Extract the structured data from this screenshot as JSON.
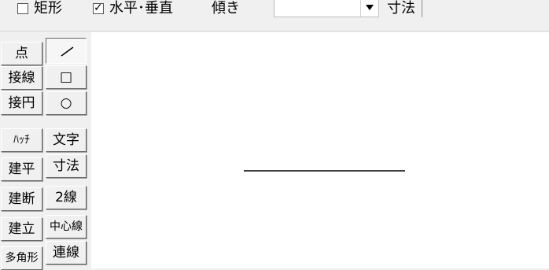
{
  "toolbar": {
    "rect_label": "矩形",
    "rect_checked": false,
    "hv_label": "水平･垂直",
    "hv_checked": true,
    "tilt_label": "傾き",
    "tilt_value": "",
    "dim_label": "寸法",
    "dim_value": ""
  },
  "left_tools": [
    "点",
    "接線",
    "接円",
    "ﾊｯﾁ",
    "建平",
    "建断",
    "建立",
    "多角形"
  ],
  "right_tools": [
    "",
    "□",
    "○",
    "文字",
    "寸法",
    "2線",
    "中心線",
    "連線"
  ],
  "right_selected_index": 0,
  "colors": {
    "panel": "#f0f0f0",
    "canvas": "#ffffff",
    "line": "#000000"
  }
}
